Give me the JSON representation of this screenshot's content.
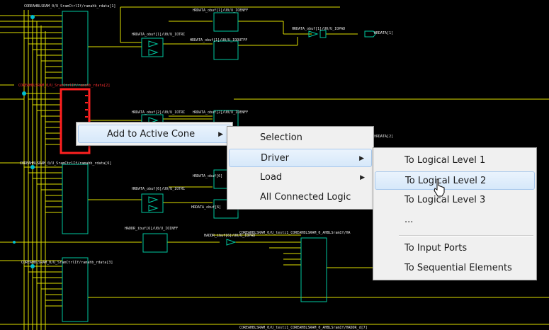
{
  "schematic": {
    "labels": [
      {
        "text": "COREAHBLSRAM_0/U_SramCtrlIf/ramahb_rdata[1]",
        "red": false
      },
      {
        "text": "HRDATA_obuf[1]/U0/U_IOENFF",
        "red": false
      },
      {
        "text": "HRDATA_obuf[1]/U0/U_IOTRI",
        "red": false
      },
      {
        "text": "HRDATA_obuf[1]/U0/U_IOOUTFF",
        "red": false
      },
      {
        "text": "HRDATA_obuf[1]/U0/U_IOPAD",
        "red": false
      },
      {
        "text": "HRDATA[1]",
        "red": false
      },
      {
        "text": "COREAHBLSRAM_0/U_SramCtrlIf/ramahb_rdata[2]",
        "red": true
      },
      {
        "text": "HRDATA_obuf[2]/U0/U_IOTRI",
        "red": false
      },
      {
        "text": "HRDATA_obuf[2]/U0/U_IOENFF",
        "red": false
      },
      {
        "text": "HRDATA[2]",
        "red": false
      },
      {
        "text": "COREAHBLSRAM_0/U_SramCtrlIf/ramahb_rdata[6]",
        "red": false
      },
      {
        "text": "HRDATA_obuf[6]",
        "red": false
      },
      {
        "text": "HRDATA_obuf[6]/U0/U_IOTRI",
        "red": false
      },
      {
        "text": "HRDATA_obuf[6]",
        "red": false
      },
      {
        "text": "HADDR_ibuf[6]/U0/U_IOINFF",
        "red": false
      },
      {
        "text": "HADDR_ibuf[6]/U0/U_IOPAD",
        "red": false
      },
      {
        "text": "COREAHBLSRAM_0/U_testi1_COREAHBLSRAM_0_AHBLSramIf/HA",
        "red": false
      },
      {
        "text": "COREAHBLSRAM_0/U_SramCtrlIf/ramahb_rdata[3]",
        "red": false
      },
      {
        "text": "COREAHBLSRAM_0/U_testi1_COREAHBLSRAM_0_AHBLSramIf/HADDR_d[7]",
        "red": false
      }
    ]
  },
  "menus": {
    "main": {
      "items": [
        {
          "label": "Add to Active Cone",
          "arrow": "▶"
        }
      ]
    },
    "sub1": {
      "items": [
        {
          "label": "Selection",
          "arrow": ""
        },
        {
          "label": "Driver",
          "arrow": "▶"
        },
        {
          "label": "Load",
          "arrow": "▶"
        },
        {
          "label": "All Connected Logic",
          "arrow": ""
        }
      ]
    },
    "sub2": {
      "items": [
        {
          "label": "To Logical Level 1"
        },
        {
          "label": "To Logical Level 2"
        },
        {
          "label": "To Logical Level 3"
        },
        {
          "label": "..."
        },
        {
          "label": "To Input Ports"
        },
        {
          "label": "To Sequential Elements"
        }
      ]
    }
  },
  "colors": {
    "background": "#000000",
    "wire": "#e0e000",
    "block": "#00c8a0",
    "selected": "#ff2020",
    "junction": "#00c0d0"
  }
}
